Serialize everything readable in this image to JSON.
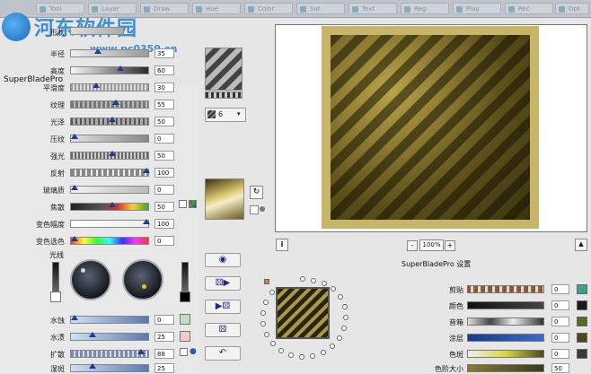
{
  "tabs": [
    "Tool",
    "Layer",
    "Draw",
    "Hue",
    "Color",
    "Sat",
    "Text",
    "Reg",
    "Play",
    "Rec",
    "Opt"
  ],
  "watermark": {
    "name": "河东软件园",
    "url": "www.pc0359.cn"
  },
  "window_title": "SuperBladePro",
  "params": [
    {
      "label": "形状",
      "value": ""
    },
    {
      "label": "半径",
      "value": "35"
    },
    {
      "label": "高度",
      "value": "60"
    },
    {
      "label": "平滑度",
      "value": "30"
    },
    {
      "label": "纹理",
      "value": "55"
    },
    {
      "label": "光泽",
      "value": "50"
    },
    {
      "label": "压纹",
      "value": "0"
    },
    {
      "label": "强光",
      "value": "50"
    },
    {
      "label": "反射",
      "value": "100"
    },
    {
      "label": "玻璃质",
      "value": "0"
    },
    {
      "label": "焦散",
      "value": "50"
    },
    {
      "label": "变色幅度",
      "value": "100"
    },
    {
      "label": "变色选色",
      "value": "0"
    }
  ],
  "light_label": "光线",
  "bottom_params": [
    {
      "label": "水蚀",
      "value": "0"
    },
    {
      "label": "水渍",
      "value": "25"
    },
    {
      "label": "扩散",
      "value": "88"
    },
    {
      "label": "湿斑",
      "value": "25"
    }
  ],
  "texture_select": {
    "value": "6"
  },
  "zoom": {
    "value": "100%",
    "minus": "-",
    "plus": "+"
  },
  "info_btn": "i",
  "settings_title": "SuperBladePro 设置",
  "right_params": [
    {
      "label": "剪贴",
      "value": "0",
      "color": "#3aa08a"
    },
    {
      "label": "颜色",
      "value": "0",
      "color": "#1a1a1a"
    },
    {
      "label": "音箱",
      "value": "0",
      "color": "#5a6a20"
    },
    {
      "label": "涂层",
      "value": "0",
      "color": "#4a4a1a"
    },
    {
      "label": "色斑",
      "value": "0",
      "color": "#3a3a3a"
    },
    {
      "label": "色阶大小",
      "value": "50",
      "color": ""
    }
  ]
}
